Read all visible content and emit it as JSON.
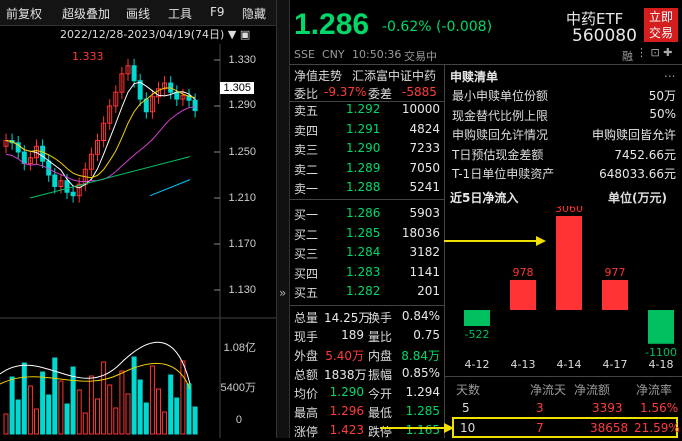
{
  "toolbar": {
    "items": [
      "前复权",
      "超级叠加",
      "画线",
      "工具",
      "F9",
      "隐藏"
    ]
  },
  "chart": {
    "date_range": "2022/12/28-2023/04/19(74日)",
    "high_marker": "1.333",
    "current_price_tag": "1.305",
    "price_axis": [
      "1.330",
      "1.290",
      "1.250",
      "1.210",
      "1.170",
      "1.130"
    ],
    "volume_axis": [
      "1.08亿",
      "5400万",
      "0"
    ],
    "collapse_glyph": "»"
  },
  "quote": {
    "price": "1.286",
    "change_pct": "-0.62%",
    "change_abs": "(-0.008)",
    "name": "中药ETF",
    "code": "560080",
    "trade_btn": [
      "立即",
      "交易"
    ],
    "exchange": "SSE",
    "currency": "CNY",
    "time": "10:50:36",
    "status": "交易中",
    "flags": "融"
  },
  "tabs": {
    "nav": "净值走势",
    "index": "汇添富中证中药"
  },
  "weibi": {
    "label1": "委比",
    "value1": "-9.37%",
    "label2": "委差",
    "value2": "-5885"
  },
  "asks": [
    {
      "label": "卖五",
      "price": "1.292",
      "vol": "10000"
    },
    {
      "label": "卖四",
      "price": "1.291",
      "vol": "4824"
    },
    {
      "label": "卖三",
      "price": "1.290",
      "vol": "7233"
    },
    {
      "label": "卖二",
      "price": "1.289",
      "vol": "7050"
    },
    {
      "label": "卖一",
      "price": "1.288",
      "vol": "5241"
    }
  ],
  "bids": [
    {
      "label": "买一",
      "price": "1.286",
      "vol": "5903"
    },
    {
      "label": "买二",
      "price": "1.285",
      "vol": "18036"
    },
    {
      "label": "买三",
      "price": "1.284",
      "vol": "3182"
    },
    {
      "label": "买四",
      "price": "1.283",
      "vol": "1141"
    },
    {
      "label": "买五",
      "price": "1.282",
      "vol": "201"
    }
  ],
  "stats": [
    [
      {
        "l": "总量",
        "v": "14.25万",
        "c": "white"
      },
      {
        "l": "换手",
        "v": "0.84%",
        "c": "white"
      }
    ],
    [
      {
        "l": "现手",
        "v": "189",
        "c": "white"
      },
      {
        "l": "量比",
        "v": "0.75",
        "c": "white"
      }
    ],
    [
      {
        "l": "外盘",
        "v": "5.40万",
        "c": "red"
      },
      {
        "l": "内盘",
        "v": "8.84万",
        "c": "green"
      }
    ],
    [
      {
        "l": "总额",
        "v": "1838万",
        "c": "white"
      },
      {
        "l": "振幅",
        "v": "0.85%",
        "c": "white"
      }
    ],
    [
      {
        "l": "均价",
        "v": "1.290",
        "c": "green"
      },
      {
        "l": "今开",
        "v": "1.294",
        "c": "white"
      }
    ],
    [
      {
        "l": "最高",
        "v": "1.296",
        "c": "red"
      },
      {
        "l": "最低",
        "v": "1.285",
        "c": "green"
      }
    ],
    [
      {
        "l": "涨停",
        "v": "1.423",
        "c": "red"
      },
      {
        "l": "跌停",
        "v": "1.165",
        "c": "green"
      }
    ]
  ],
  "redeem": {
    "title": "申赎清单",
    "more": "...",
    "rows": [
      {
        "l": "最小申赎单位份额",
        "v": "50万"
      },
      {
        "l": "现金替代比例上限",
        "v": "50%"
      },
      {
        "l": "申购赎回允许情况",
        "v": "申购赎回皆允许"
      },
      {
        "l": "T日预估现金差额",
        "v": "7452.66元"
      },
      {
        "l": "T-1日单位申赎资产",
        "v": "648033.66元"
      }
    ]
  },
  "inflow": {
    "title": "近5日净流入",
    "unit": "单位(万元)"
  },
  "chart_data": {
    "type": "bar",
    "categories": [
      "4-12",
      "4-13",
      "4-14",
      "4-17",
      "4-18"
    ],
    "values": [
      -522,
      978,
      3060,
      977,
      -1100
    ],
    "labels": [
      "-522",
      "978",
      "3060",
      "977",
      "-1100"
    ]
  },
  "summary": {
    "headers": [
      "天数",
      "净流天",
      "净流额",
      "净流率"
    ],
    "rows": [
      {
        "days": "5",
        "pos": "3",
        "amt": "3393",
        "rate": "1.56%"
      },
      {
        "days": "10",
        "pos": "7",
        "amt": "38658",
        "rate": "21.59%"
      }
    ]
  },
  "colors": {
    "up": "#ff3333",
    "down": "#00c060",
    "ma5": "#ffffff",
    "ma10": "#f0d000",
    "ma20": "#d040d0",
    "ma60": "#00c060",
    "ma120": "#00c8ff"
  }
}
